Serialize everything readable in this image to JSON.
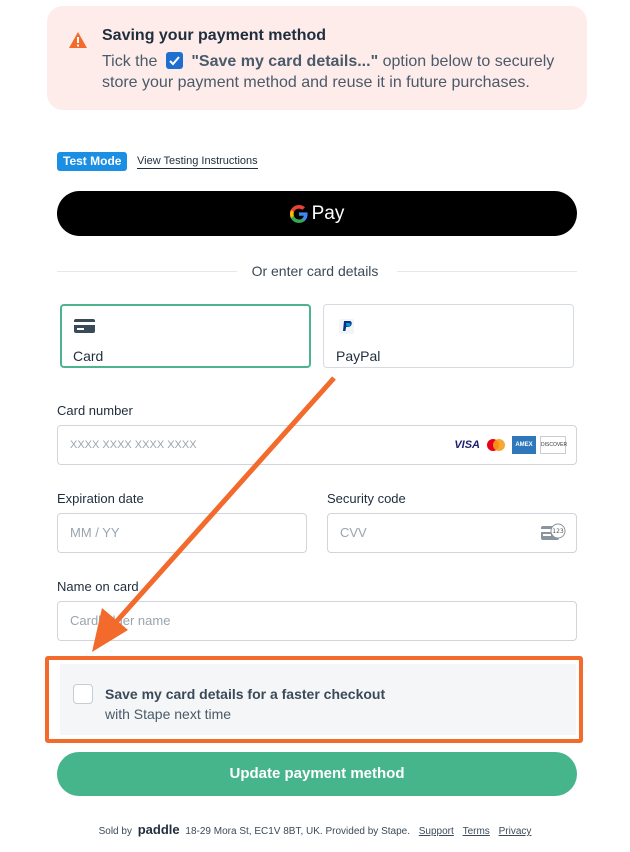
{
  "notice": {
    "title": "Saving your payment method",
    "line1_prefix": "Tick the",
    "line1_bold": "\"Save my card details...\"",
    "line1_suffix": "option below to securely",
    "line2": "store your payment method and reuse it in future purchases."
  },
  "test_mode": {
    "badge": "Test Mode",
    "link": "View Testing Instructions"
  },
  "gpay": {
    "label": "Pay"
  },
  "divider": {
    "text": "Or enter card details"
  },
  "methods": [
    {
      "label": "Card",
      "icon": "credit-card-icon",
      "selected": true
    },
    {
      "label": "PayPal",
      "icon": "paypal-icon",
      "selected": false
    }
  ],
  "form": {
    "card_number": {
      "label": "Card number",
      "placeholder": "XXXX XXXX XXXX XXXX"
    },
    "expiration": {
      "label": "Expiration date",
      "placeholder": "MM / YY"
    },
    "security": {
      "label": "Security code",
      "placeholder": "CVV"
    },
    "name": {
      "label": "Name on card",
      "placeholder": "Cardholder name"
    },
    "card_brands": [
      "VISA",
      "mastercard",
      "AMEX",
      "DISCOVER"
    ]
  },
  "save": {
    "title": "Save my card details for a faster checkout",
    "subtitle": "with Stape next time",
    "checked": false
  },
  "submit": {
    "label": "Update payment method"
  },
  "footer": {
    "sold_by": "Sold by",
    "brand": "paddle",
    "address": "18-29 Mora St, EC1V 8BT, UK. Provided by Stape.",
    "support": "Support",
    "terms": "Terms",
    "privacy": "Privacy"
  },
  "colors": {
    "accent_green": "#47b58b",
    "highlight_orange": "#f26b2d",
    "notice_bg": "#fdecea",
    "test_badge": "#1a8fe3"
  }
}
